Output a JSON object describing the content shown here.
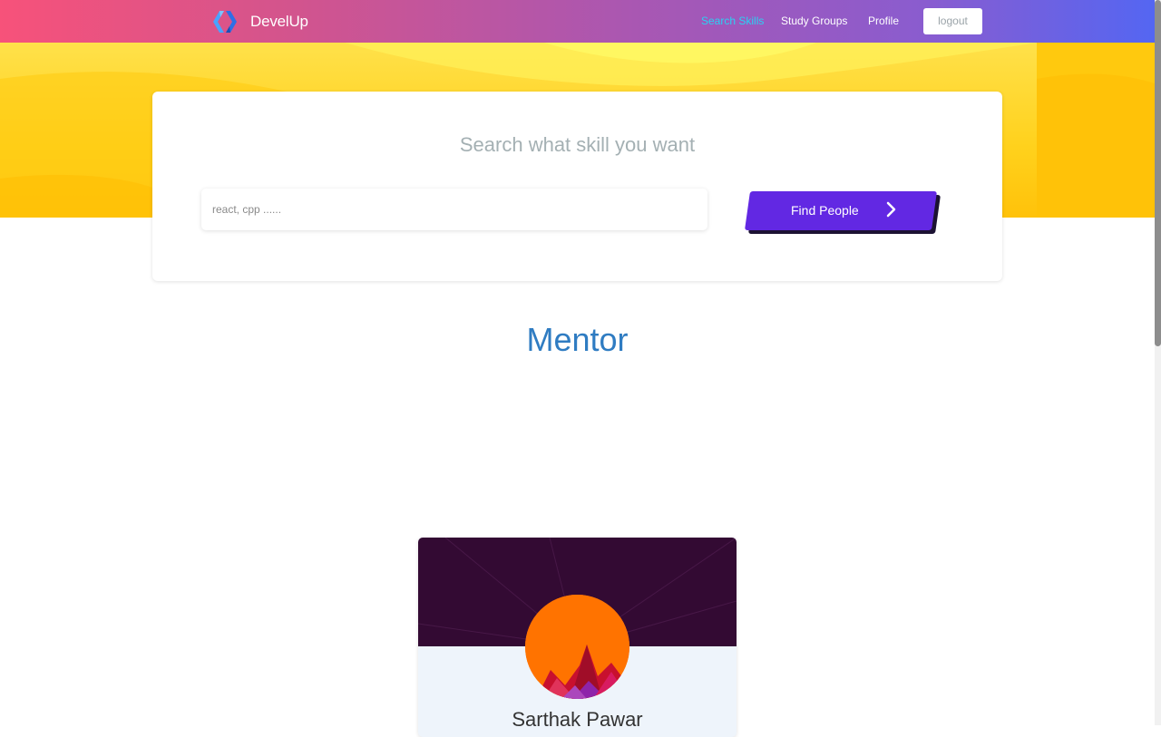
{
  "nav": {
    "brand": "DevelUp",
    "links": [
      {
        "label": "Search Skills",
        "active": true
      },
      {
        "label": "Study Groups",
        "active": false
      },
      {
        "label": "Profile",
        "active": false
      }
    ],
    "logout": "logout"
  },
  "search": {
    "title": "Search what skill you want",
    "placeholder": "react, cpp ......",
    "button_label": "Find People"
  },
  "section": {
    "title": "Mentor"
  },
  "mentor": {
    "name": "Sarthak Pawar"
  },
  "colors": {
    "nav_gradient_start": "#f7527a",
    "nav_gradient_end": "#5466f2",
    "active_link": "#29d2f3",
    "hero_yellow": "#ffd11c",
    "button_purple": "#6228e3",
    "section_title": "#2f7cc2",
    "card_banner": "#330a33",
    "avatar_bg": "#ff7300"
  }
}
